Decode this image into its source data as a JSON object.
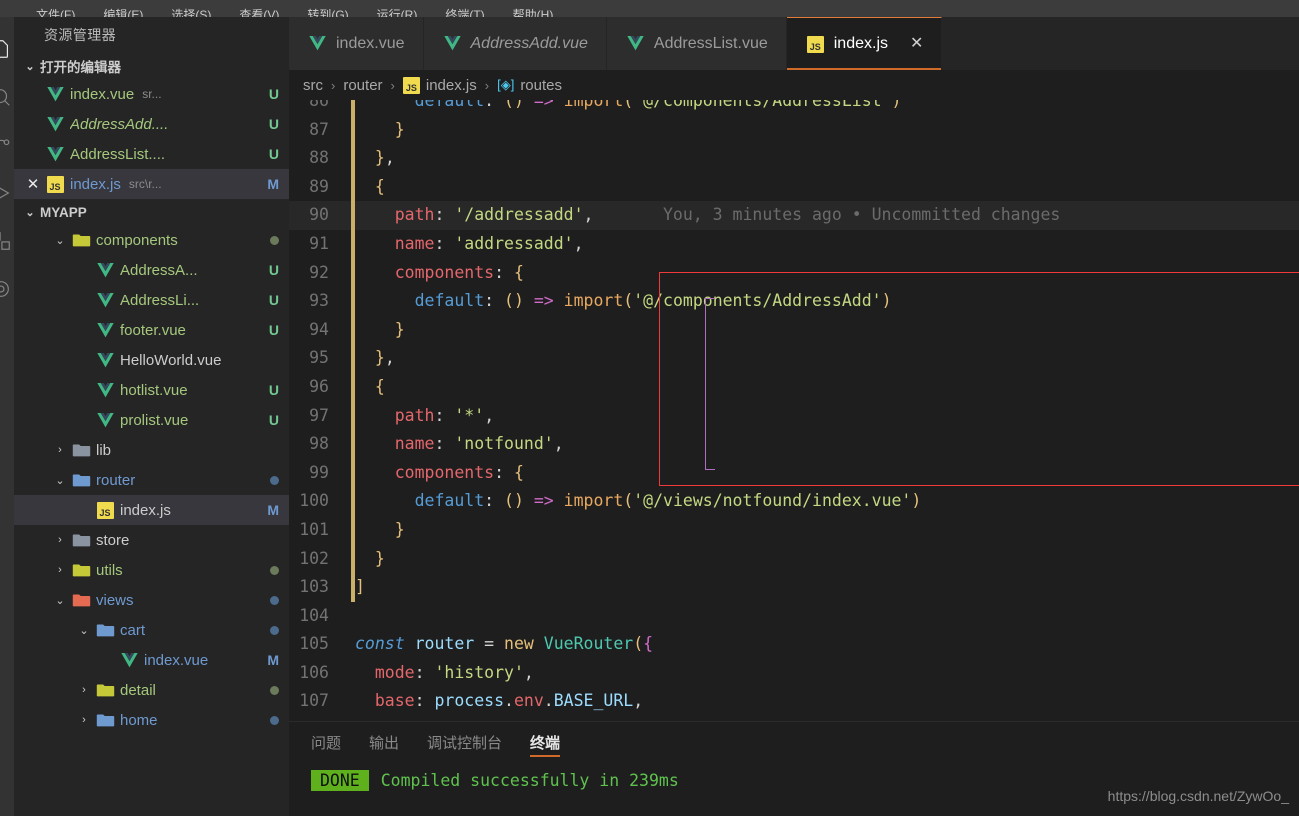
{
  "menubar": {
    "items": [
      "文件(F)",
      "编辑(E)",
      "选择(S)",
      "查看(V)",
      "转到(G)",
      "运行(R)",
      "终端(T)",
      "帮助(H)"
    ]
  },
  "activitybar": {
    "items": [
      {
        "name": "explorer-icon",
        "label": "资源管理器"
      },
      {
        "name": "search-icon",
        "label": "搜索"
      },
      {
        "name": "source-control-icon",
        "label": "源代码管理"
      },
      {
        "name": "run-debug-icon",
        "label": "运行和调试"
      },
      {
        "name": "extensions-icon",
        "label": "扩展"
      }
    ]
  },
  "sidebar": {
    "title": "资源管理器",
    "open_editors": {
      "header": "打开的编辑器",
      "twisty": "⌄",
      "items": [
        {
          "name": "index.vue",
          "path": "sr...",
          "badge": "U",
          "icon": "vue-icon",
          "italic": false,
          "selected": false,
          "dirty": false
        },
        {
          "name": "AddressAdd....",
          "path": "",
          "badge": "U",
          "icon": "vue-icon",
          "italic": true,
          "selected": false,
          "dirty": false
        },
        {
          "name": "AddressList....",
          "path": "",
          "badge": "U",
          "icon": "vue-icon",
          "italic": false,
          "selected": false,
          "dirty": false
        },
        {
          "name": "index.js",
          "path": "src\\r...",
          "badge": "M",
          "icon": "js-icon",
          "italic": false,
          "selected": true,
          "dirty": false
        }
      ]
    },
    "project": {
      "header": "MYAPP",
      "twisty": "⌄",
      "tree": [
        {
          "label": "components",
          "type": "folder",
          "indent": 1,
          "twisty": "⌄",
          "color": "green",
          "dot": "#6a7a5a",
          "badge": ""
        },
        {
          "label": "AddressA...",
          "type": "vue",
          "indent": 2,
          "twisty": "",
          "color": "green",
          "dot": "",
          "badge": "U"
        },
        {
          "label": "AddressLi...",
          "type": "vue",
          "indent": 2,
          "twisty": "",
          "color": "green",
          "dot": "",
          "badge": "U"
        },
        {
          "label": "footer.vue",
          "type": "vue",
          "indent": 2,
          "twisty": "",
          "color": "green",
          "dot": "",
          "badge": "U"
        },
        {
          "label": "HelloWorld.vue",
          "type": "vue",
          "indent": 2,
          "twisty": "",
          "color": "plain",
          "dot": "",
          "badge": ""
        },
        {
          "label": "hotlist.vue",
          "type": "vue",
          "indent": 2,
          "twisty": "",
          "color": "green",
          "dot": "",
          "badge": "U"
        },
        {
          "label": "prolist.vue",
          "type": "vue",
          "indent": 2,
          "twisty": "",
          "color": "green",
          "dot": "",
          "badge": "U"
        },
        {
          "label": "lib",
          "type": "folder",
          "indent": 1,
          "twisty": "›",
          "color": "plain",
          "dot": "",
          "badge": ""
        },
        {
          "label": "router",
          "type": "folder",
          "indent": 1,
          "twisty": "⌄",
          "color": "blue",
          "dot": "#4c6a8c",
          "badge": ""
        },
        {
          "label": "index.js",
          "type": "js",
          "indent": 2,
          "twisty": "",
          "color": "plain",
          "dot": "",
          "badge": "M",
          "selected": true
        },
        {
          "label": "store",
          "type": "folder",
          "indent": 1,
          "twisty": "›",
          "color": "plain",
          "dot": "",
          "badge": ""
        },
        {
          "label": "utils",
          "type": "folder",
          "indent": 1,
          "twisty": "›",
          "color": "green",
          "dot": "#6a7a5a",
          "badge": ""
        },
        {
          "label": "views",
          "type": "folder",
          "indent": 1,
          "twisty": "⌄",
          "color": "blue",
          "dot": "#4c6a8c",
          "badge": ""
        },
        {
          "label": "cart",
          "type": "folder",
          "indent": 2,
          "twisty": "⌄",
          "color": "blue",
          "dot": "#4c6a8c",
          "badge": ""
        },
        {
          "label": "index.vue",
          "type": "vue",
          "indent": 3,
          "twisty": "",
          "color": "blue",
          "dot": "",
          "badge": "M"
        },
        {
          "label": "detail",
          "type": "folder",
          "indent": 2,
          "twisty": "›",
          "color": "green",
          "dot": "#6a7a5a",
          "badge": ""
        },
        {
          "label": "home",
          "type": "folder",
          "indent": 2,
          "twisty": "›",
          "color": "blue",
          "dot": "#4c6a8c",
          "badge": ""
        }
      ]
    }
  },
  "tabs": [
    {
      "label": "index.vue",
      "icon": "vue-icon",
      "active": false,
      "italic": false,
      "close": ""
    },
    {
      "label": "AddressAdd.vue",
      "icon": "vue-icon",
      "active": false,
      "italic": true,
      "close": ""
    },
    {
      "label": "AddressList.vue",
      "icon": "vue-icon",
      "active": false,
      "italic": false,
      "close": ""
    },
    {
      "label": "index.js",
      "icon": "js-icon",
      "active": true,
      "italic": false,
      "close": "✕"
    }
  ],
  "breadcrumbs": [
    {
      "label": "src",
      "icon": ""
    },
    {
      "label": "router",
      "icon": ""
    },
    {
      "label": "index.js",
      "icon": "js-icon"
    },
    {
      "label": "routes",
      "icon": "symbol-object-icon"
    }
  ],
  "breadcrumb_separator": "›",
  "editor": {
    "blame_annotation": "You, 3 minutes ago • Uncommitted changes",
    "lines": [
      {
        "num": "86",
        "clipped": true,
        "text": "      default: () => import('@/components/AddressList')"
      },
      {
        "num": "87",
        "text": "    }"
      },
      {
        "num": "88",
        "text": "  },"
      },
      {
        "num": "89",
        "text": "  {"
      },
      {
        "num": "90",
        "text": "    path: '/addressadd',",
        "current": true
      },
      {
        "num": "91",
        "text": "    name: 'addressadd',"
      },
      {
        "num": "92",
        "text": "    components: {"
      },
      {
        "num": "93",
        "text": "      default: () => import('@/components/AddressAdd')"
      },
      {
        "num": "94",
        "text": "    }"
      },
      {
        "num": "95",
        "text": "  },"
      },
      {
        "num": "96",
        "text": "  {"
      },
      {
        "num": "97",
        "text": "    path: '*',"
      },
      {
        "num": "98",
        "text": "    name: 'notfound',"
      },
      {
        "num": "99",
        "text": "    components: {"
      },
      {
        "num": "100",
        "text": "      default: () => import('@/views/notfound/index.vue')"
      },
      {
        "num": "101",
        "text": "    }"
      },
      {
        "num": "102",
        "text": "  }"
      },
      {
        "num": "103",
        "text": "]"
      },
      {
        "num": "104",
        "text": ""
      },
      {
        "num": "105",
        "text": "const router = new VueRouter({"
      },
      {
        "num": "106",
        "text": "  mode: 'history',"
      },
      {
        "num": "107",
        "text": "  base: process.env.BASE_URL,"
      }
    ]
  },
  "panel": {
    "tabs": [
      {
        "label": "问题",
        "active": false
      },
      {
        "label": "输出",
        "active": false
      },
      {
        "label": "调试控制台",
        "active": false
      },
      {
        "label": "终端",
        "active": true
      }
    ],
    "terminal": {
      "badge": "DONE",
      "message": "Compiled successfully in 239ms"
    }
  },
  "watermark": "https://blog.csdn.net/ZywOo_",
  "colors": {
    "accent": "#cf6a2b",
    "annotation_red": "#ee3a3a",
    "scope_purple": "#b06ec2",
    "modified_gutter": "#cbb06a",
    "done_badge": "#5fb01d",
    "terminal_green": "#5fc24e"
  }
}
